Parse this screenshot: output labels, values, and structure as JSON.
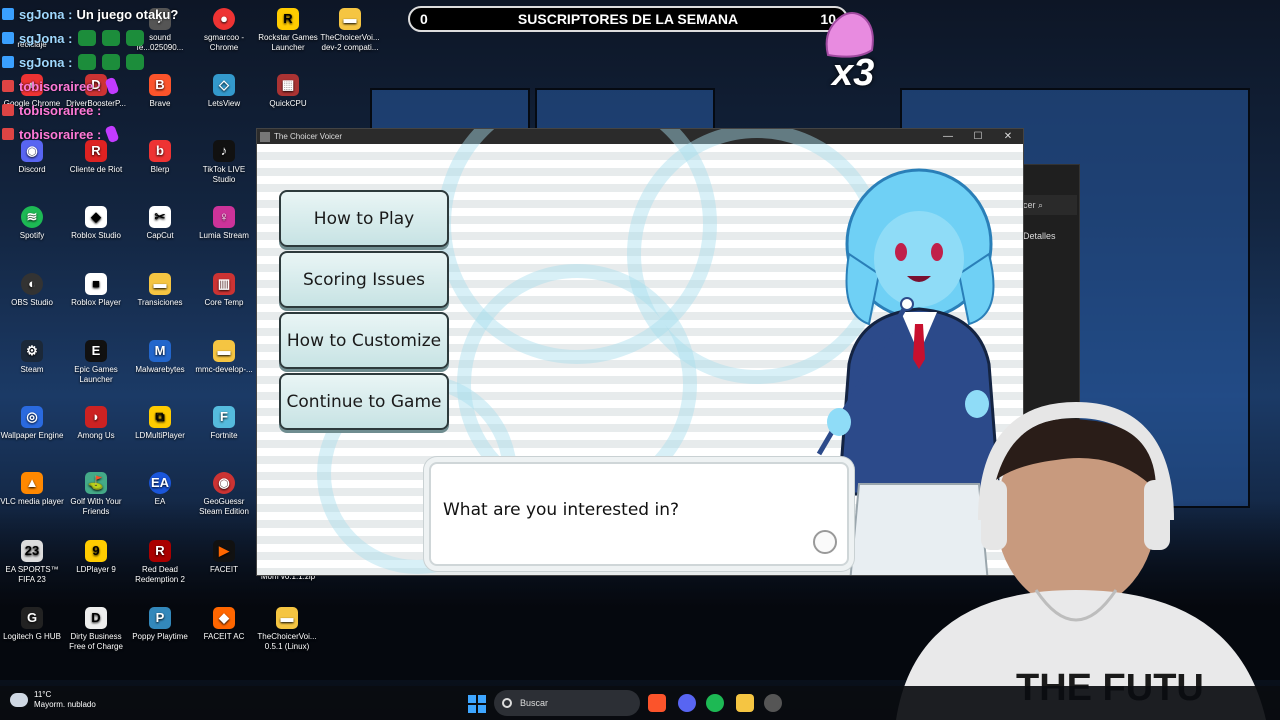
{
  "chat": [
    {
      "user": "sgJona :",
      "message": "Un juego otaku?",
      "color": "blue",
      "emotes": 0
    },
    {
      "user": "sgJona :",
      "message": "",
      "color": "blue",
      "emotes": 3
    },
    {
      "user": "sgJona :",
      "message": "",
      "color": "blue",
      "emotes": 3
    },
    {
      "user": "tobisorairee :",
      "message": "",
      "color": "pink",
      "emotes": 1
    },
    {
      "user": "tobisorairee :",
      "message": "",
      "color": "pink",
      "emotes": 0
    },
    {
      "user": "tobisorairee :",
      "message": "",
      "color": "pink",
      "emotes": 1
    }
  ],
  "sub_bar": {
    "left": "0",
    "title": "SUSCRIPTORES DE LA SEMANA",
    "right": "10"
  },
  "multiplier": "x3",
  "desktop": {
    "col1": [
      "Google Chrome",
      "Discord",
      "Spotify",
      "OBS Studio",
      "Steam",
      "Wallpaper Engine",
      "VLC media player",
      "EA SPORTS™ FIFA 23",
      "Logitech G HUB"
    ],
    "col2": [
      "DriverBoosterP...",
      "Cliente de Riot",
      "Roblox Studio",
      "Roblox Player",
      "Epic Games Launcher",
      "Among Us",
      "Golf With Your Friends",
      "LDPlayer 9",
      "Dirty Business Free of Charge"
    ],
    "col3": [
      "sound fe...025090...",
      "Brave",
      "Blerp",
      "CapCut",
      "Transiciones",
      "Malwarebytes",
      "LDMultiPlayer",
      "EA",
      "Red Dead Redemption 2",
      "Poppy Playtime"
    ],
    "col4": [
      "sgmarcoo - Chrome",
      "LetsView",
      "TikTok LIVE Studio",
      "Lumia Stream",
      "Core Temp",
      "mmc-develop-...",
      "Fortnite",
      "GeoGuessr Steam Edition",
      "FACEIT",
      "FACEIT AC"
    ],
    "col5": [
      "Rockstar Games Launcher",
      "QuickCPU"
    ],
    "col6": [
      "TheChoicerVoi... dev-2 compati...",
      "TheChoicerVoi... 0.5.1 (Linux)"
    ],
    "small": [
      "reciclaje",
      "Mom v0.1.1.zip"
    ]
  },
  "window": {
    "title": "The Choicer Voicer",
    "minimize": "—",
    "maximize": "☐",
    "close": "✕"
  },
  "menu": [
    "How to Play",
    "Scoring Issues",
    "How to Customize",
    "Continue to Game"
  ],
  "dialog": {
    "prompt": "What are you interested in?"
  },
  "bg_window": {
    "search": "icer",
    "details": "Detalles"
  },
  "taskbar": {
    "temp": "11°C",
    "weather": "Mayorm. nublado",
    "search": "Buscar"
  },
  "webcam": {
    "shirt_text": "THE FUTU"
  }
}
